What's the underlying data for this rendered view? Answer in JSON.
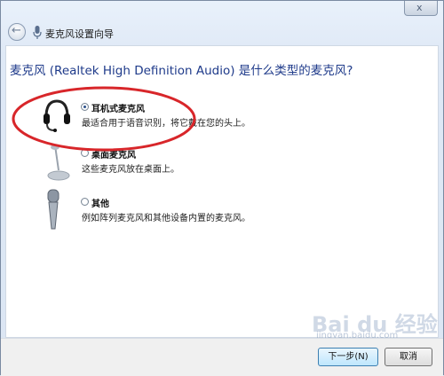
{
  "window": {
    "title": "麦克风设置向导",
    "close_symbol": "x"
  },
  "main": {
    "question": "麦克风 (Realtek High Definition Audio) 是什么类型的麦克风?",
    "options": [
      {
        "title": "耳机式麦克风",
        "description": "最适合用于语音识别，将它戴在您的头上。",
        "selected": true,
        "icon": "headset-icon"
      },
      {
        "title": "桌面麦克风",
        "description": "这些麦克风放在桌面上。",
        "selected": false,
        "icon": "desktop-microphone-icon"
      },
      {
        "title": "其他",
        "description": "例如阵列麦克风和其他设备内置的麦克风。",
        "selected": false,
        "icon": "handheld-microphone-icon"
      }
    ]
  },
  "footer": {
    "next_label": "下一步(N)",
    "cancel_label": "取消"
  },
  "watermark": {
    "text": "Bai du 经验",
    "subtext": "jingyan.baidu.com"
  },
  "colors": {
    "question": "#1e3a8a",
    "annotation_circle": "#d8262a"
  }
}
